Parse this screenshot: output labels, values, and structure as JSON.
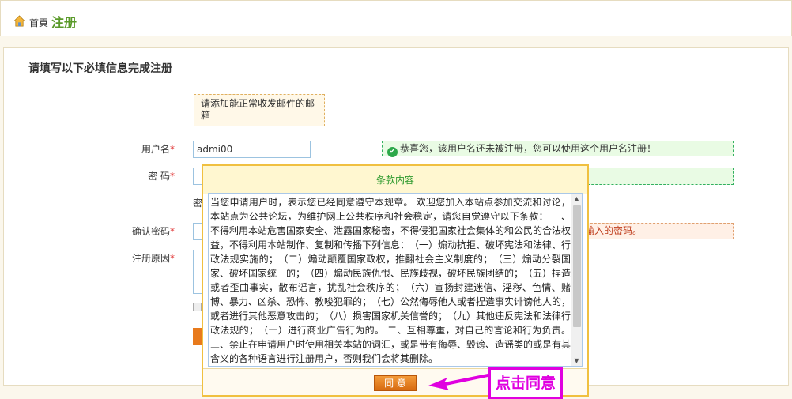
{
  "breadcrumb": {
    "home": "首頁",
    "current": "注册"
  },
  "form": {
    "title": "请填写以下必填信息完成注册",
    "email_tip": "请添加能正常收发邮件的邮箱",
    "username_label": "用户名",
    "username_value": "admi00",
    "username_ok": "恭喜您，该用户名还未被注册，您可以使用这个用户名注册！",
    "password_label": "密 码",
    "password_value": "••",
    "password_hint_partial": "密",
    "confirm_label": "确认密码",
    "confirm_value": "••",
    "confirm_error_partial": "输入的密码。",
    "reason_label": "注册原因",
    "required_mark": "*"
  },
  "dialog": {
    "title": "条款内容",
    "terms": "当您申请用户时，表示您已经同意遵守本规章。 欢迎您加入本站点参加交流和讨论，本站点为公共论坛，为维护网上公共秩序和社会稳定，请您自觉遵守以下条款： 一、不得利用本站危害国家安全、泄露国家秘密，不得侵犯国家社会集体的和公民的合法权益，不得利用本站制作、复制和传播下列信息：　（一）煽动抗拒、破坏宪法和法律、行政法规实施的；　（二）煽动颠覆国家政权，推翻社会主义制度的；　（三）煽动分裂国家、破坏国家统一的；　（四）煽动民族仇恨、民族歧视，破坏民族团结的；　（五）捏造或者歪曲事实，散布谣言，扰乱社会秩序的；　（六）宣扬封建迷信、淫秽、色情、赌博、暴力、凶杀、恐怖、教唆犯罪的；　（七）公然侮辱他人或者捏造事实诽谤他人的，或者进行其他恶意攻击的；　（八）损害国家机关信誉的；　（九）其他违反宪法和法律行政法规的；　（十）进行商业广告行为的。 二、互相尊重，对自己的言论和行为负责。 三、禁止在申请用户时使用相关本站的词汇，或是带有侮辱、毁谤、造谣类的或是有其含义的各种语言进行注册用户，否则我们会将其删除。",
    "agree_label": "同 意"
  },
  "annotation": {
    "text": "点击同意",
    "color": "#e000e0"
  },
  "colors": {
    "accent_orange": "#e87a1c",
    "success_green": "#2da84a",
    "title_green": "#5a9a2a"
  }
}
